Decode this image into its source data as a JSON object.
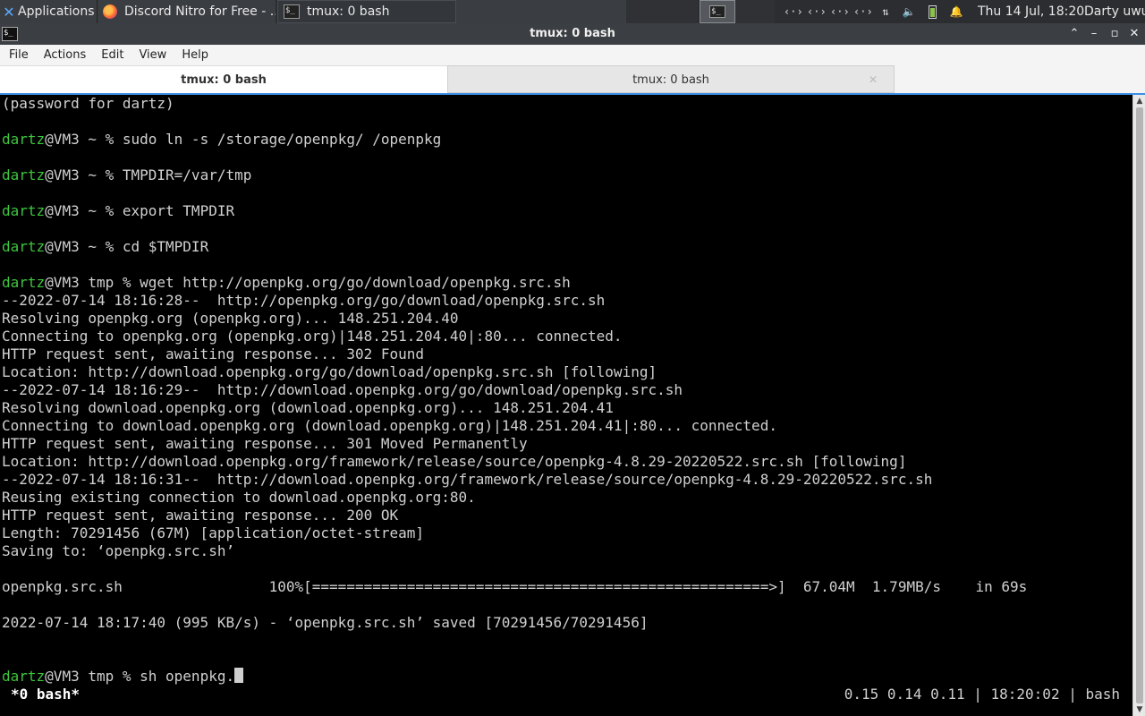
{
  "panel": {
    "applications_label": "Applications",
    "tasks": [
      {
        "label": "Discord Nitro for Free - ...",
        "icon": "firefox-icon"
      },
      {
        "label": "tmux: 0 bash",
        "icon": "terminal-icon"
      }
    ],
    "tray_icons": [
      "network-icon",
      "network-icon",
      "network-icon",
      "network-icon",
      "transfer-icon",
      "volume-icon",
      "battery-icon",
      "notification-bell-icon"
    ],
    "clock": "Thu 14 Jul, 18:20",
    "user": "Darty uwu"
  },
  "window": {
    "title": "tmux: 0 bash",
    "controls": [
      "maximize-up-icon",
      "minimize-icon",
      "restore-icon",
      "close-icon"
    ]
  },
  "menu": [
    "File",
    "Actions",
    "Edit",
    "View",
    "Help"
  ],
  "tabs": [
    {
      "label": "tmux: 0 bash",
      "active": true
    },
    {
      "label": "tmux: 0 bash",
      "active": false
    }
  ],
  "terminal": {
    "lines": [
      {
        "user": "",
        "text": "(password for dartz)"
      },
      {
        "user": "",
        "text": ""
      },
      {
        "user": "dartz",
        "text": "@VM3 ~ % sudo ln -s /storage/openpkg/ /openpkg"
      },
      {
        "user": "",
        "text": ""
      },
      {
        "user": "dartz",
        "text": "@VM3 ~ % TMPDIR=/var/tmp"
      },
      {
        "user": "",
        "text": ""
      },
      {
        "user": "dartz",
        "text": "@VM3 ~ % export TMPDIR"
      },
      {
        "user": "",
        "text": ""
      },
      {
        "user": "dartz",
        "text": "@VM3 ~ % cd $TMPDIR"
      },
      {
        "user": "",
        "text": ""
      },
      {
        "user": "dartz",
        "text": "@VM3 tmp % wget http://openpkg.org/go/download/openpkg.src.sh"
      },
      {
        "user": "",
        "text": "--2022-07-14 18:16:28--  http://openpkg.org/go/download/openpkg.src.sh"
      },
      {
        "user": "",
        "text": "Resolving openpkg.org (openpkg.org)... 148.251.204.40"
      },
      {
        "user": "",
        "text": "Connecting to openpkg.org (openpkg.org)|148.251.204.40|:80... connected."
      },
      {
        "user": "",
        "text": "HTTP request sent, awaiting response... 302 Found"
      },
      {
        "user": "",
        "text": "Location: http://download.openpkg.org/go/download/openpkg.src.sh [following]"
      },
      {
        "user": "",
        "text": "--2022-07-14 18:16:29--  http://download.openpkg.org/go/download/openpkg.src.sh"
      },
      {
        "user": "",
        "text": "Resolving download.openpkg.org (download.openpkg.org)... 148.251.204.41"
      },
      {
        "user": "",
        "text": "Connecting to download.openpkg.org (download.openpkg.org)|148.251.204.41|:80... connected."
      },
      {
        "user": "",
        "text": "HTTP request sent, awaiting response... 301 Moved Permanently"
      },
      {
        "user": "",
        "text": "Location: http://download.openpkg.org/framework/release/source/openpkg-4.8.29-20220522.src.sh [following]"
      },
      {
        "user": "",
        "text": "--2022-07-14 18:16:31--  http://download.openpkg.org/framework/release/source/openpkg-4.8.29-20220522.src.sh"
      },
      {
        "user": "",
        "text": "Reusing existing connection to download.openpkg.org:80."
      },
      {
        "user": "",
        "text": "HTTP request sent, awaiting response... 200 OK"
      },
      {
        "user": "",
        "text": "Length: 70291456 (67M) [application/octet-stream]"
      },
      {
        "user": "",
        "text": "Saving to: ‘openpkg.src.sh’"
      },
      {
        "user": "",
        "text": ""
      },
      {
        "user": "",
        "text": "openpkg.src.sh                 100%[=====================================================>]  67.04M  1.79MB/s    in 69s"
      },
      {
        "user": "",
        "text": ""
      },
      {
        "user": "",
        "text": "2022-07-14 18:17:40 (995 KB/s) - ‘openpkg.src.sh’ saved [70291456/70291456]"
      },
      {
        "user": "",
        "text": ""
      },
      {
        "user": "",
        "text": ""
      }
    ],
    "prompt_user": "dartz",
    "prompt_text": "@VM3 tmp % sh openpkg.",
    "status_left": "*0 bash*",
    "status_right": "0.15 0.14 0.11 | 18:20:02 | bash"
  }
}
